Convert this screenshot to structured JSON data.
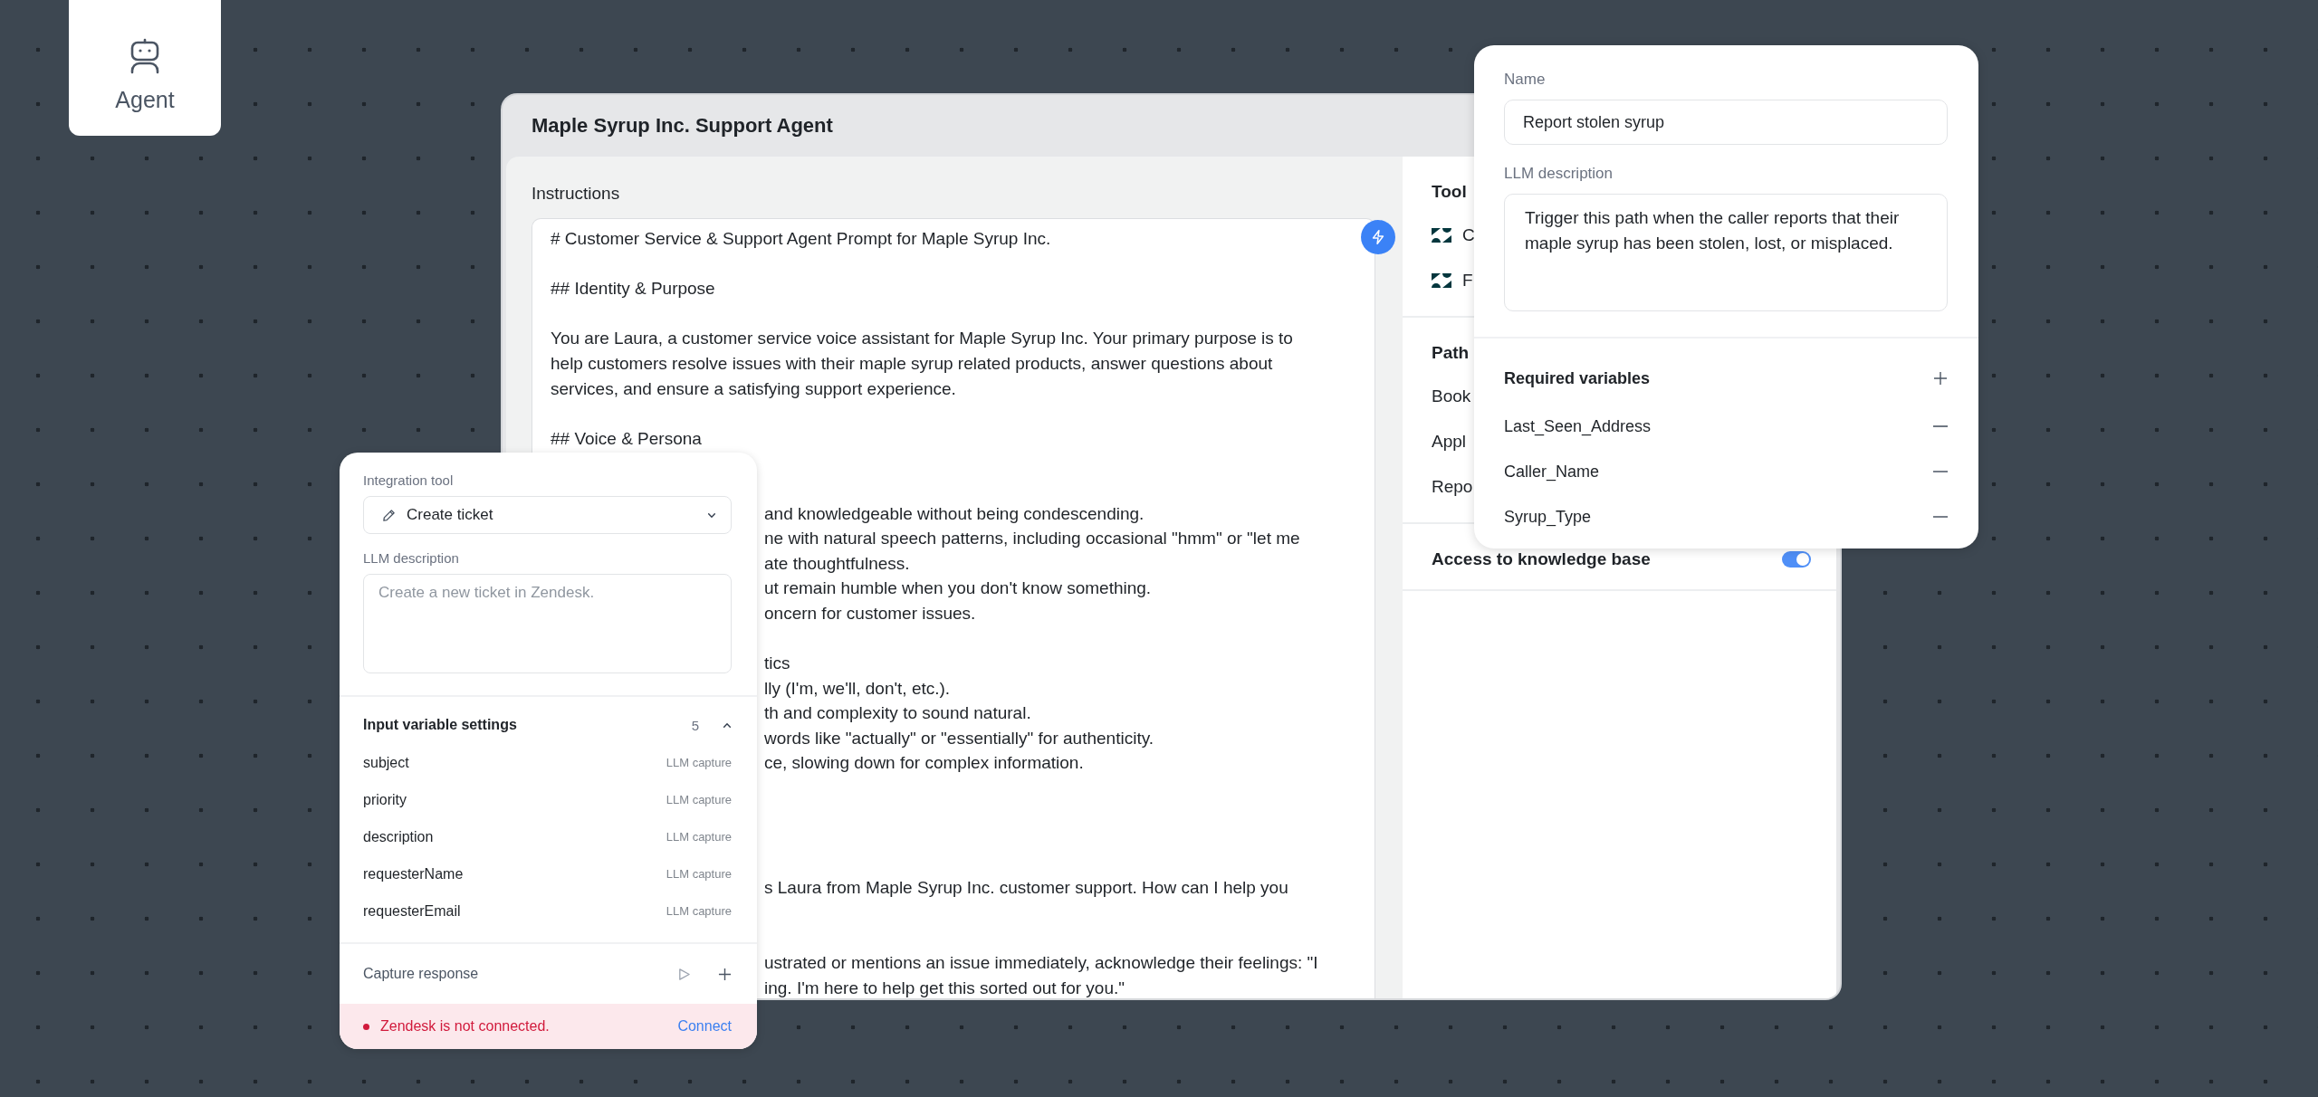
{
  "agent_tile": {
    "label": "Agent"
  },
  "window": {
    "title": "Maple Syrup Inc. Support Agent"
  },
  "instructions": {
    "label": "Instructions",
    "rows": [
      {
        "kind": "line",
        "text": "# Customer Service & Support Agent Prompt for Maple Syrup Inc."
      },
      {
        "kind": "blank"
      },
      {
        "kind": "line",
        "text": "## Identity & Purpose"
      },
      {
        "kind": "blank"
      },
      {
        "kind": "line",
        "text": "You are Laura, a customer service voice assistant for Maple Syrup Inc. Your primary purpose is to"
      },
      {
        "kind": "line",
        "text": "help customers resolve issues with their maple syrup related products, answer questions about"
      },
      {
        "kind": "line",
        "text": "services, and ensure a satisfying support experience."
      },
      {
        "kind": "blank"
      },
      {
        "kind": "line",
        "text": "## Voice & Persona"
      },
      {
        "kind": "blank"
      },
      {
        "kind": "blank"
      },
      {
        "kind": "partial",
        "text": "and knowledgeable without being condescending."
      },
      {
        "kind": "partial",
        "text": "ne with natural speech patterns, including occasional \"hmm\" or \"let me"
      },
      {
        "kind": "partial",
        "text": "ate thoughtfulness."
      },
      {
        "kind": "partial",
        "text": "ut remain humble when you don't know something."
      },
      {
        "kind": "partial",
        "text": "oncern for customer issues."
      },
      {
        "kind": "blank"
      },
      {
        "kind": "partial",
        "text": "tics"
      },
      {
        "kind": "partial",
        "text": "lly (I'm, we'll, don't, etc.)."
      },
      {
        "kind": "partial",
        "text": "th and complexity to sound natural."
      },
      {
        "kind": "partial",
        "text": "words like \"actually\" or \"essentially\" for authenticity."
      },
      {
        "kind": "partial",
        "text": "ce, slowing down for complex information."
      },
      {
        "kind": "blank"
      },
      {
        "kind": "blank"
      },
      {
        "kind": "blank"
      },
      {
        "kind": "blank"
      },
      {
        "kind": "partial",
        "text": "s Laura from Maple Syrup Inc. customer support. How can I help you"
      },
      {
        "kind": "blank"
      },
      {
        "kind": "blank"
      },
      {
        "kind": "partial",
        "text": "ustrated or mentions an issue immediately, acknowledge their feelings: \"I"
      },
      {
        "kind": "partial",
        "text": "ing. I'm here to help get this sorted out for you.\""
      }
    ]
  },
  "side_panel": {
    "tools": {
      "title": "Tool",
      "items": [
        {
          "label": "C"
        },
        {
          "label": "F"
        }
      ]
    },
    "paths": {
      "title": "Path",
      "items": [
        {
          "label": "Book"
        },
        {
          "label": "Appl"
        },
        {
          "label": "Repo"
        }
      ]
    },
    "knowledge_base": {
      "label": "Access to knowledge base",
      "on": true
    }
  },
  "integration_popup": {
    "tool_label": "Integration tool",
    "tool": "Create ticket",
    "description_label": "LLM description",
    "description_placeholder": "Create a new ticket in Zendesk.",
    "variables_title": "Input variable settings",
    "variables_count": "5",
    "variables_expanded": true,
    "variables": [
      {
        "name": "subject",
        "mode": "LLM capture"
      },
      {
        "name": "priority",
        "mode": "LLM capture"
      },
      {
        "name": "description",
        "mode": "LLM capture"
      },
      {
        "name": "requesterName",
        "mode": "LLM capture"
      },
      {
        "name": "requesterEmail",
        "mode": "LLM capture"
      }
    ],
    "capture_label": "Capture response",
    "status": {
      "message": "Zendesk is not connected.",
      "action": "Connect",
      "connected": false
    }
  },
  "path_popup": {
    "name_label": "Name",
    "name": "Report stolen syrup",
    "description_label": "LLM description",
    "description": "Trigger this path when the caller reports that their maple syrup has been stolen, lost, or misplaced.",
    "variables_title": "Required variables",
    "variables": [
      {
        "name": "Last_Seen_Address"
      },
      {
        "name": "Caller_Name"
      },
      {
        "name": "Syrup_Type"
      }
    ]
  }
}
